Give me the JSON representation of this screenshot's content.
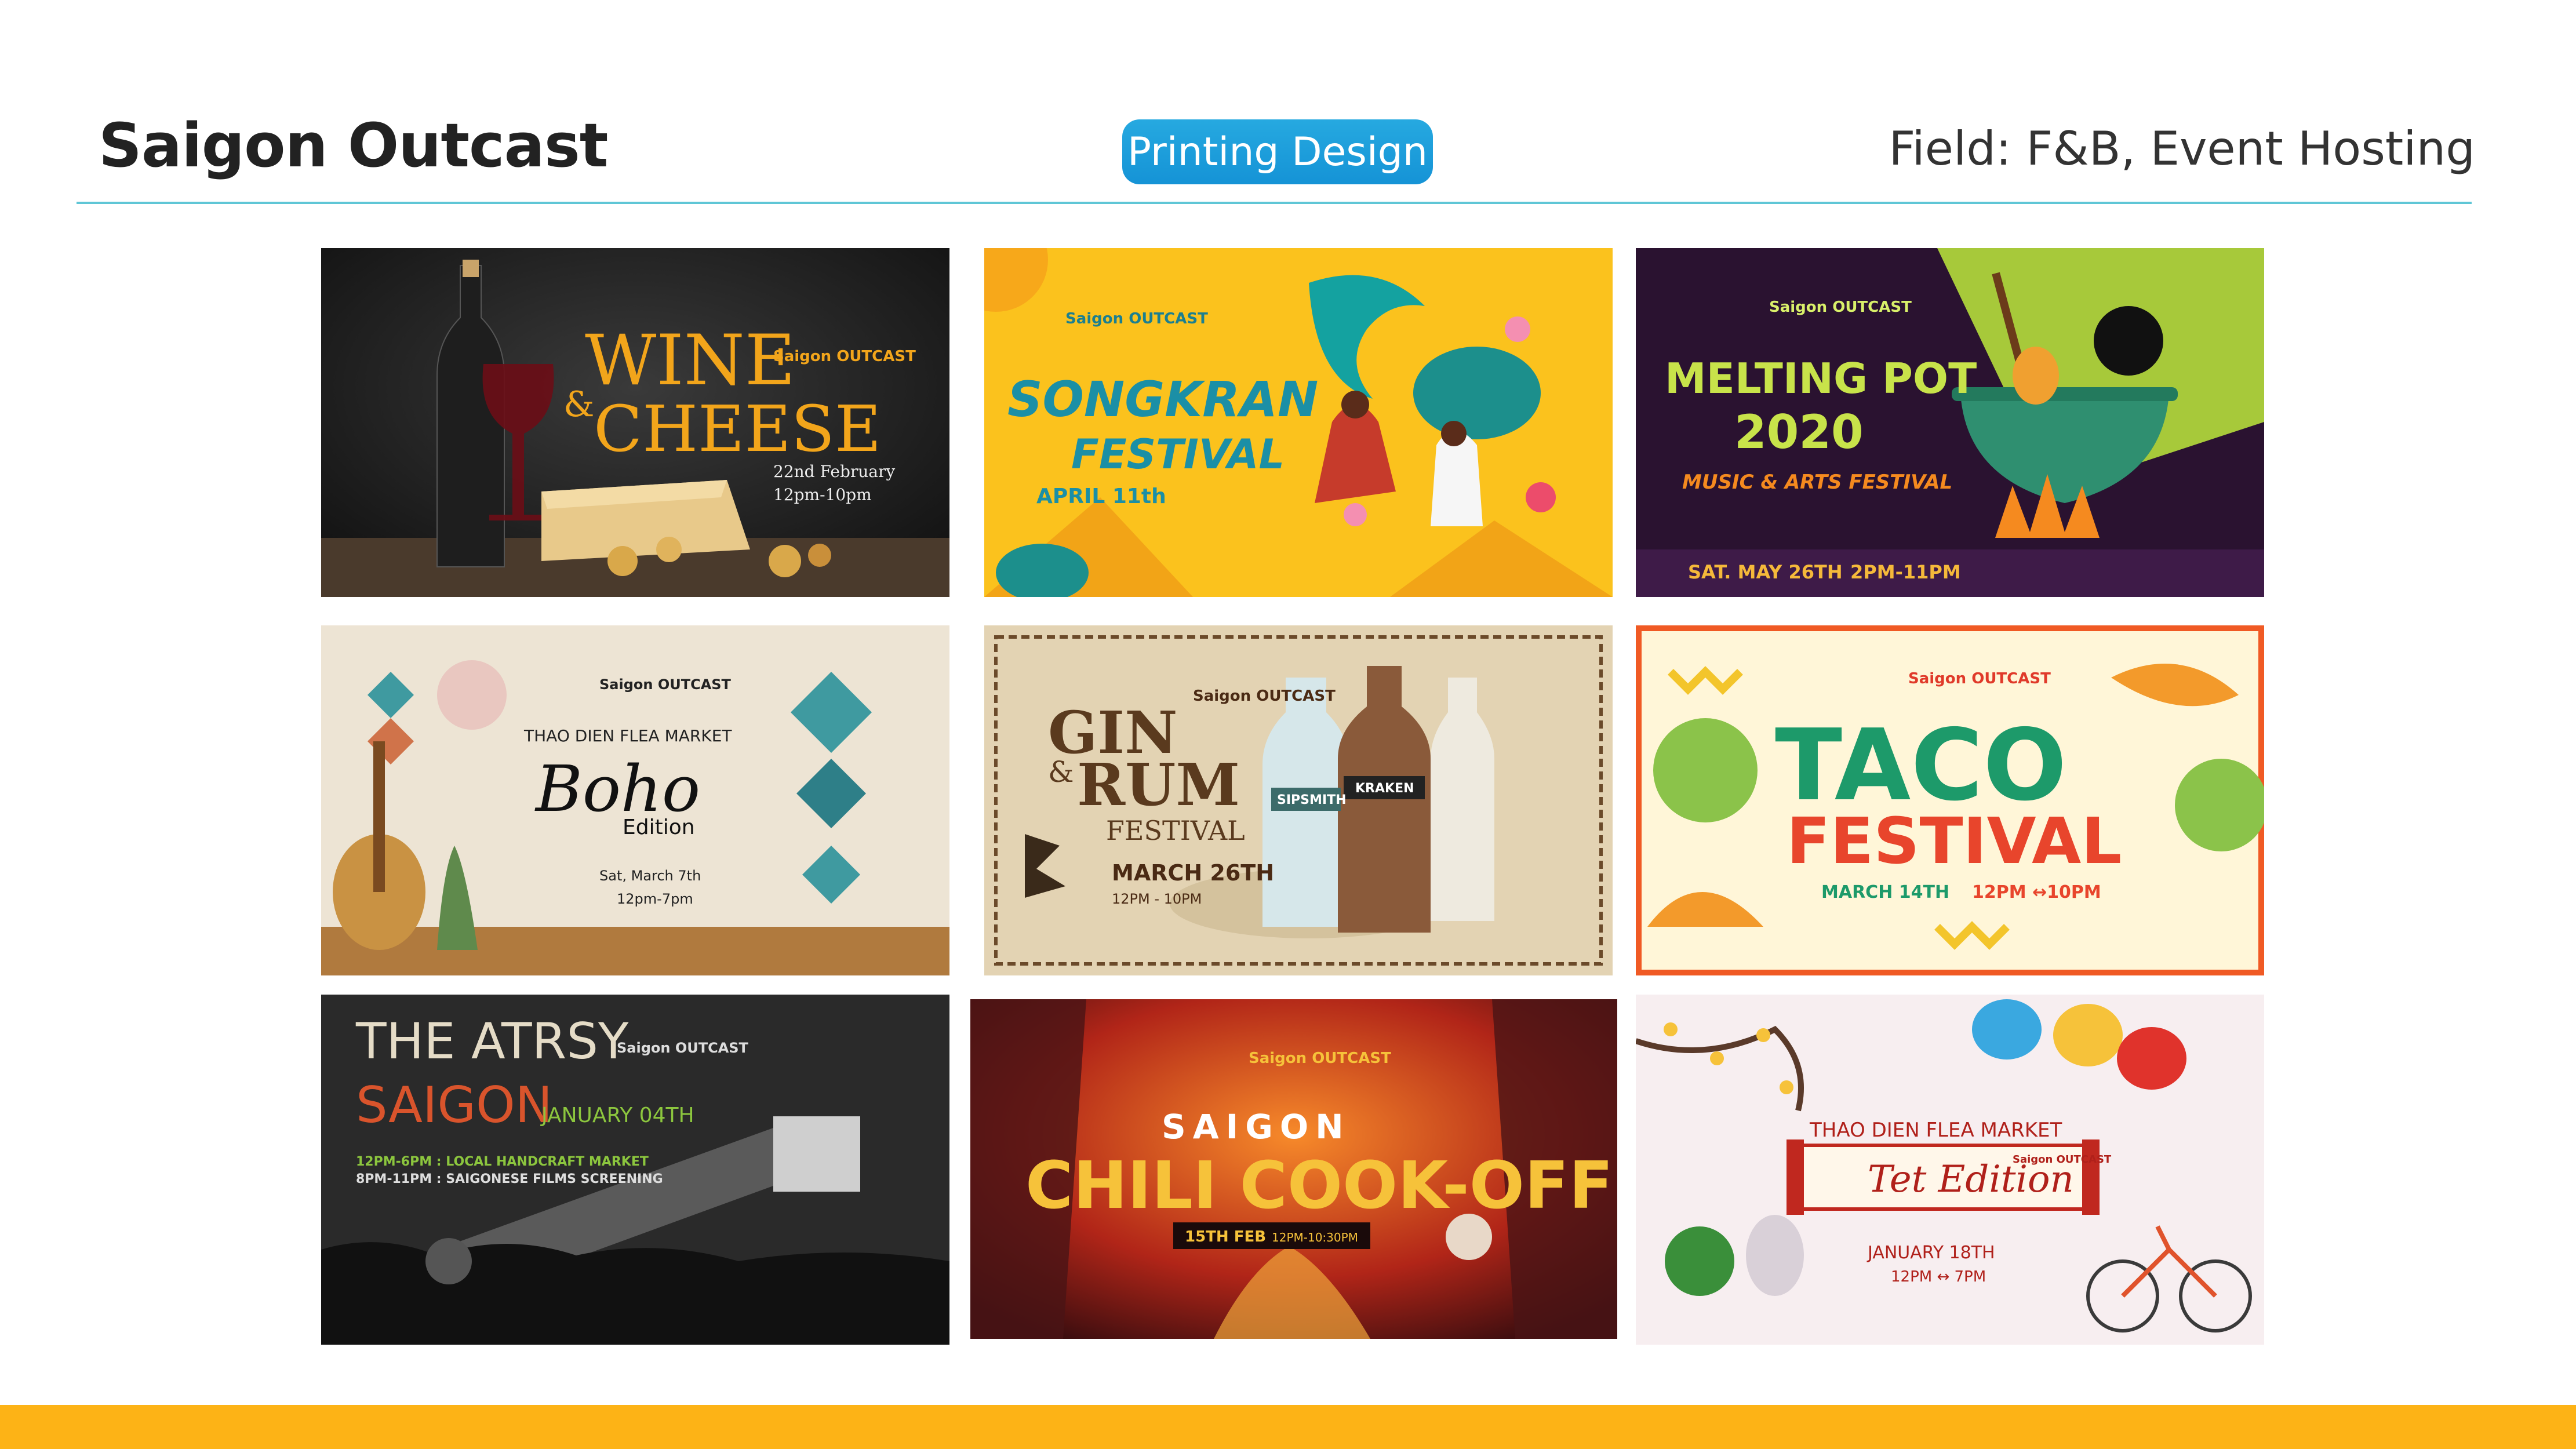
{
  "header": {
    "brand": "Saigon Outcast",
    "category": "Printing Design",
    "field": "Field: F&B, Event Hosting"
  },
  "colors": {
    "accent": "#1ea0dc",
    "rule": "#5fc6d6",
    "footer": "#fdb316"
  },
  "tiles": [
    {
      "logo": "Saigon OUTCAST",
      "title_1": "WINE",
      "title_amp": "&",
      "title_2": "CHEESE",
      "date": "22nd February",
      "time": "12pm-10pm"
    },
    {
      "logo": "Saigon OUTCAST",
      "title_1": "SONGKRAN",
      "title_2": "FESTIVAL",
      "date": "APRIL 11th"
    },
    {
      "logo": "Saigon OUTCAST",
      "title_1": "MELTING POT",
      "title_2": "2020",
      "subtitle": "MUSIC & ARTS FESTIVAL",
      "date": "SAT. MAY 26TH",
      "time": "2PM-11PM"
    },
    {
      "logo": "Saigon OUTCAST",
      "kicker": "THAO DIEN FLEA MARKET",
      "title_1": "Boho",
      "title_2": "Edition",
      "date": "Sat, March 7th",
      "time": "12pm-7pm"
    },
    {
      "logo": "Saigon OUTCAST",
      "title_1": "GIN",
      "title_amp": "&",
      "title_2": "RUM",
      "title_3": "FESTIVAL",
      "date": "MARCH 26TH",
      "time": "12PM - 10PM",
      "bottle_1": "SIPSMITH",
      "bottle_2": "KRAKEN"
    },
    {
      "logo": "Saigon OUTCAST",
      "title_1": "TACO",
      "title_2": "FESTIVAL",
      "date": "MARCH 14TH",
      "time": "12PM ↔10PM"
    },
    {
      "logo": "Saigon OUTCAST",
      "title_1": "THE ATRSY",
      "title_2": "SAIGON",
      "date": "JANUARY 04TH",
      "line_1": "12PM-6PM : LOCAL HANDCRAFT MARKET",
      "line_2": "8PM-11PM : SAIGONESE FILMS SCREENING"
    },
    {
      "logo": "Saigon OUTCAST",
      "title_1": "SAIGON",
      "title_2": "CHILI COOK-OFF",
      "date": "15TH FEB",
      "time": "12PM-10:30PM"
    },
    {
      "logo": "Saigon OUTCAST",
      "kicker": "THAO DIEN FLEA MARKET",
      "title_1": "Tet Edition",
      "date": "JANUARY 18TH",
      "time": "12PM ↔ 7PM"
    }
  ]
}
